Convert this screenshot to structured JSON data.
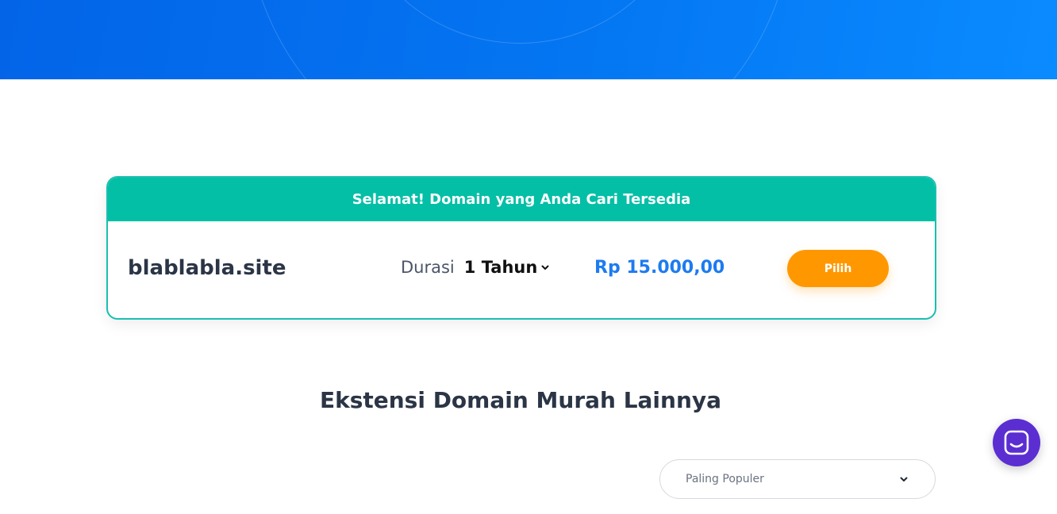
{
  "result": {
    "header_text": "Selamat! Domain yang Anda Cari Tersedia",
    "domain": "blablabla.site",
    "duration_label": "Durasi",
    "duration_value": "1 Tahun",
    "price": "Rp 15.000,00",
    "select_button": "Pilih"
  },
  "section": {
    "title": "Ekstensi Domain Murah Lainnya"
  },
  "sort": {
    "selected": "Paling Populer"
  },
  "colors": {
    "hero": "#0476f2",
    "success": "#03bfa6",
    "accent": "#1d7bf0",
    "button": "#ff9800",
    "chat": "#5b2ed1"
  },
  "icons": {
    "duration_dropdown": "chevron-down-icon",
    "sort_dropdown": "chevron-down-icon",
    "chat": "chat-icon"
  }
}
